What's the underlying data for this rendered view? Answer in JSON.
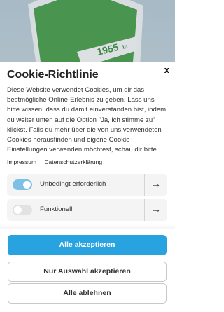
{
  "background": {
    "logo_text": "1955",
    "logo_text_small": "in"
  },
  "cookie_modal": {
    "title": "Cookie-Richtlinie",
    "close_label": "x",
    "description": "Diese Website verwendet Cookies, um dir das bestmögliche Online-Erlebnis zu geben. Lass uns bitte wissen, dass du damit einverstanden bist, indem du weiter unten auf die Option \"Ja, ich stimme zu\" klickst. Falls du mehr über die von uns verwendeten Cookies herausfinden und eigene Cookie-Einstellungen verwenden möchtest, schau dir bitte unsere Cookie-",
    "links": [
      "Impressum",
      "Datenschutzerklärung"
    ],
    "categories": [
      {
        "label": "Unbedingt erforderlich",
        "enabled": true,
        "arrow": "→"
      },
      {
        "label": "Funktionell",
        "enabled": false,
        "arrow": "→"
      }
    ]
  },
  "buttons": {
    "accept_all": "Alle akzeptieren",
    "accept_selection": "Nur Auswahl akzeptieren",
    "reject_all": "Alle ablehnen"
  },
  "colors": {
    "primary": "#29a3e0",
    "toggle_on": "#7dc0e6",
    "logo_green": "#3a9a3a"
  }
}
